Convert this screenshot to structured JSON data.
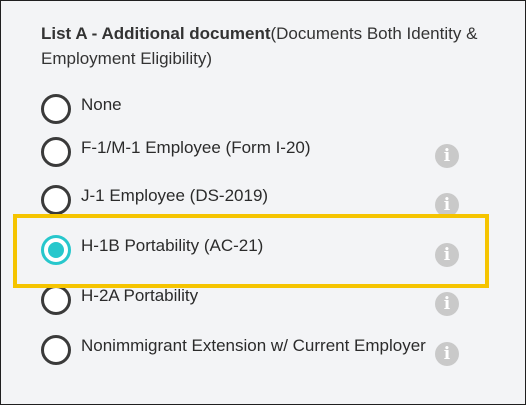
{
  "section": {
    "title_bold": "List A - Additional document",
    "title_rest": "(Documents Both Identity & Employment Eligibility)"
  },
  "options": [
    {
      "label": "None",
      "selected": false,
      "has_info": false
    },
    {
      "label": "F-1/M-1 Employee (Form I-20)",
      "selected": false,
      "has_info": true
    },
    {
      "label": "J-1 Employee (DS-2019)",
      "selected": false,
      "has_info": true
    },
    {
      "label": "H-1B Portability (AC-21)",
      "selected": true,
      "has_info": true
    },
    {
      "label": "H-2A Portability",
      "selected": false,
      "has_info": true
    },
    {
      "label": "Nonimmigrant Extension w/ Current Employer",
      "selected": false,
      "has_info": true
    }
  ],
  "info_icon": {
    "glyph": "i",
    "name": "info-icon"
  },
  "colors": {
    "accent": "#27c7cc",
    "highlight": "#f5c400",
    "info_icon": "#c9c9c9"
  }
}
